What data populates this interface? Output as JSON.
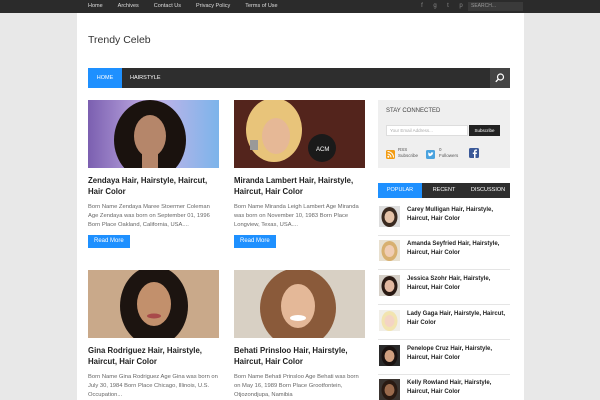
{
  "topnav": {
    "items": [
      "Home",
      "Archives",
      "Contact Us",
      "Privacy Policy",
      "Terms of Use"
    ],
    "search_placeholder": "SEARCH..."
  },
  "brand": "Trendy Celeb",
  "mainnav": {
    "home": "HOME",
    "hairstyle": "HAIRSTYLE"
  },
  "posts": [
    {
      "title": "Zendaya Hair, Hairstyle, Haircut, Hair Color",
      "excerpt": "Born Name Zendaya Maree Stoermer Coleman Age Zendaya was born on September 01, 1996 Born Place Oakland, California, USA....",
      "more": "Read More"
    },
    {
      "title": "Miranda Lambert Hair, Hairstyle, Haircut, Hair Color",
      "excerpt": "Born Name Miranda Leigh Lambert Age Miranda was born on November 10, 1983 Born Place Longview, Texas, USA....",
      "more": "Read More"
    },
    {
      "title": "Gina Rodriguez Hair, Hairstyle, Haircut, Hair Color",
      "excerpt": "Born Name Gina Rodriguez Age Gina was born on July 30, 1984 Born Place Chicago, Illinois, U.S. Occupation..."
    },
    {
      "title": "Behati Prinsloo Hair, Hairstyle, Haircut, Hair Color",
      "excerpt": "Born Name Behati Prinsloo Age Behati was born on May 16, 1989 Born Place Grootfontein, Otjozondjupa, Namibia"
    }
  ],
  "sidebar": {
    "stay_connected": "STAY CONNECTED",
    "email_placeholder": "Your Email Address...",
    "subscribe": "Subscribe",
    "rss_label": "RSS",
    "rss_sub": "Subscribe",
    "twitter_count": "0",
    "twitter_sub": "Followers",
    "tabs": [
      "POPULAR",
      "RECENT",
      "DISCUSSION"
    ],
    "popular": [
      "Carey Mulligan Hair, Hairstyle, Haircut, Hair Color",
      "Amanda Seyfried Hair, Hairstyle, Haircut, Hair Color",
      "Jessica Szohr Hair, Hairstyle, Haircut, Hair Color",
      "Lady Gaga Hair, Hairstyle, Haircut, Hair Color",
      "Penelope Cruz Hair, Hairstyle, Haircut, Hair Color",
      "Kelly Rowland Hair, Hairstyle, Haircut, Hair Color"
    ]
  },
  "colors": {
    "accent": "#1e90ff",
    "nav": "#2e2e2e",
    "topbar": "#2b2b2b"
  }
}
